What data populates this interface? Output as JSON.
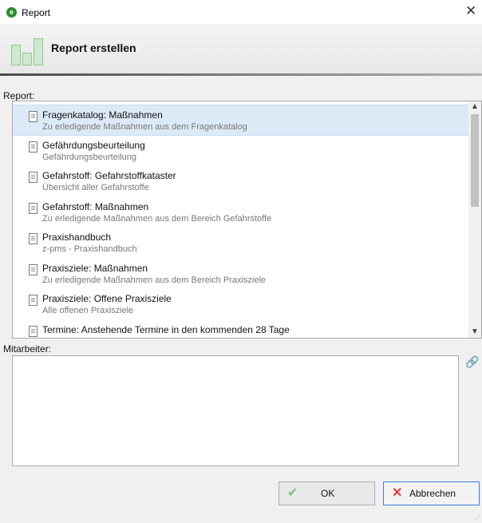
{
  "window": {
    "title": "Report",
    "app_icon_letter": "e"
  },
  "header": {
    "title": "Report erstellen"
  },
  "report": {
    "label": "Report:",
    "items": [
      {
        "title": "Fragenkatalog:  Maßnahmen",
        "subtitle": "Zu erledigende Maßnahmen aus dem Fragenkatalog",
        "selected": true
      },
      {
        "title": "Gefährdungsbeurteilung",
        "subtitle": "Gefährdungsbeurteilung"
      },
      {
        "title": "Gefahrstoff: Gefahrstoffkataster",
        "subtitle": "Übersicht aller Gefahrstoffe"
      },
      {
        "title": "Gefahrstoff: Maßnahmen",
        "subtitle": "Zu erledigende Maßnahmen aus dem Bereich Gefahrstoffe"
      },
      {
        "title": "Praxishandbuch",
        "subtitle": "z-pms - Praxishandbuch"
      },
      {
        "title": "Praxisziele: Maßnahmen",
        "subtitle": "Zu erledigende Maßnahmen aus dem Bereich Praxisziele"
      },
      {
        "title": "Praxisziele: Offene Praxisziele",
        "subtitle": "Alle offenen Praxisziele"
      },
      {
        "title": "Termine: Anstehende Termine in den kommenden 28 Tage",
        "subtitle": ""
      }
    ]
  },
  "mitarbeiter": {
    "label": "Mitarbeiter:",
    "value": ""
  },
  "buttons": {
    "ok_label": "OK",
    "cancel_label": "Abbrechen"
  },
  "icons": {
    "doc": "document-icon",
    "link": "link-icon",
    "ok": "checkmark-icon",
    "cancel": "cross-icon"
  },
  "colors": {
    "selection": "#dceaf7",
    "ok_check": "#7cc07c",
    "cancel_x": "#e23b3b",
    "logo": "#8fc98f"
  }
}
